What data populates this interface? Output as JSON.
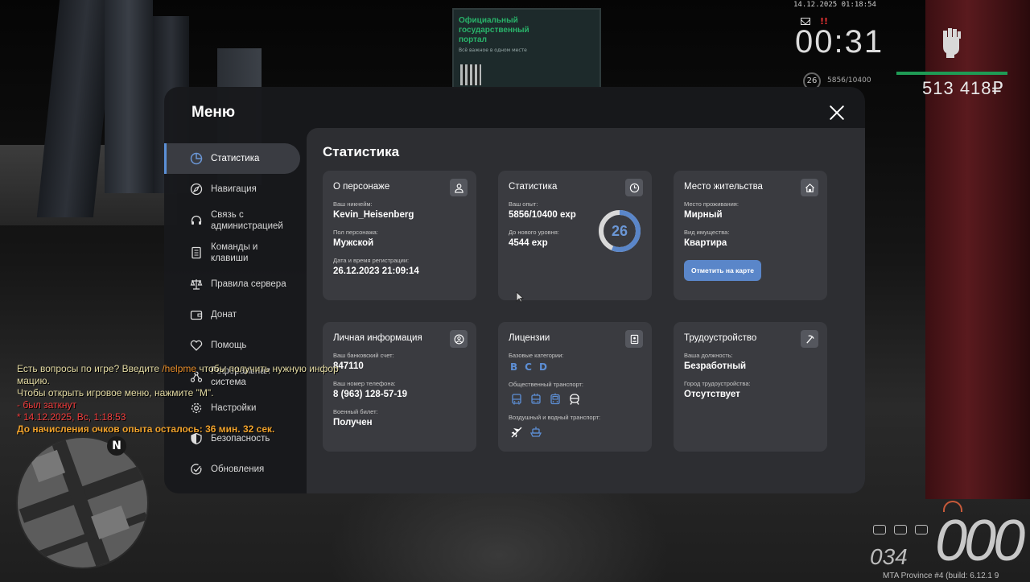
{
  "hud": {
    "datetime": "14.12.2025 01:18:54",
    "alert": "!!",
    "time": "00:31",
    "level": "26",
    "exp": "5856/10400",
    "money": "513 418₽"
  },
  "billboard": {
    "title": "Официальный государственный портал",
    "subtitle": "Всё важное в одном месте"
  },
  "menu": {
    "title": "Меню",
    "sidebar": [
      {
        "label": "Статистика",
        "icon": "chart-pie-icon"
      },
      {
        "label": "Навигация",
        "icon": "compass-icon"
      },
      {
        "label": "Связь с администрацией",
        "icon": "headset-icon"
      },
      {
        "label": "Команды и клавиши",
        "icon": "document-icon"
      },
      {
        "label": "Правила сервера",
        "icon": "scales-icon"
      },
      {
        "label": "Донат",
        "icon": "wallet-icon"
      },
      {
        "label": "Помощь",
        "icon": "heart-icon"
      },
      {
        "label": "Реферальная система",
        "icon": "network-icon"
      },
      {
        "label": "Настройки",
        "icon": "gear-icon"
      },
      {
        "label": "Безопасность",
        "icon": "shield-icon"
      },
      {
        "label": "Обновления",
        "icon": "check-circle-icon"
      }
    ]
  },
  "content": {
    "title": "Статистика",
    "character": {
      "title": "О персонаже",
      "nick_label": "Ваш никнейм:",
      "nick": "Kevin_Heisenberg",
      "sex_label": "Пол персонажа:",
      "sex": "Мужской",
      "reg_label": "Дата и время регистрации:",
      "reg": "26.12.2023 21:09:14"
    },
    "stats": {
      "title": "Статистика",
      "exp_label": "Ваш опыт:",
      "exp": "5856/10400 exp",
      "next_label": "До нового уровня:",
      "next": "4544 exp",
      "level": "26",
      "progress": 0.563
    },
    "residence": {
      "title": "Место жительства",
      "place_label": "Место проживания:",
      "place": "Мирный",
      "type_label": "Вид имущества:",
      "type": "Квартира",
      "button": "Отметить на карте"
    },
    "personal": {
      "title": "Личная информация",
      "bank_label": "Ваш банковский счет:",
      "bank": "847110",
      "phone_label": "Ваш номер телефона:",
      "phone": "8 (963) 128-57-19",
      "military_label": "Военный билет:",
      "military": "Получен"
    },
    "licenses": {
      "title": "Лицензии",
      "base_label": "Базовые категории:",
      "categories": [
        "B",
        "C",
        "D"
      ],
      "public_label": "Общественный транспорт:",
      "air_label": "Воздушный и водный транспорт:"
    },
    "job": {
      "title": "Трудоустройство",
      "position_label": "Ваша должность:",
      "position": "Безработный",
      "city_label": "Город трудоустройства:",
      "city": "Отсутствует"
    }
  },
  "chat": {
    "line1a": "Есть вопросы по игре? Введите ",
    "line1cmd": "/helpme",
    "line1b": " чтобы получить нужную инфор",
    "line2": "мацию.",
    "line3": "Чтобы открыть игровое меню, нажмите \"M\".",
    "line4": "- был заткнут",
    "line5": "* 14.12.2025, Вс, 1:18:53",
    "line6": "До начисления очков опыта осталось: 36 мин. 32 сек."
  },
  "minimap": {
    "north": "N"
  },
  "speedometer": {
    "speed": "000",
    "fuel": "034"
  },
  "build": "MTA Province #4 (build: 6.12.1 9"
}
